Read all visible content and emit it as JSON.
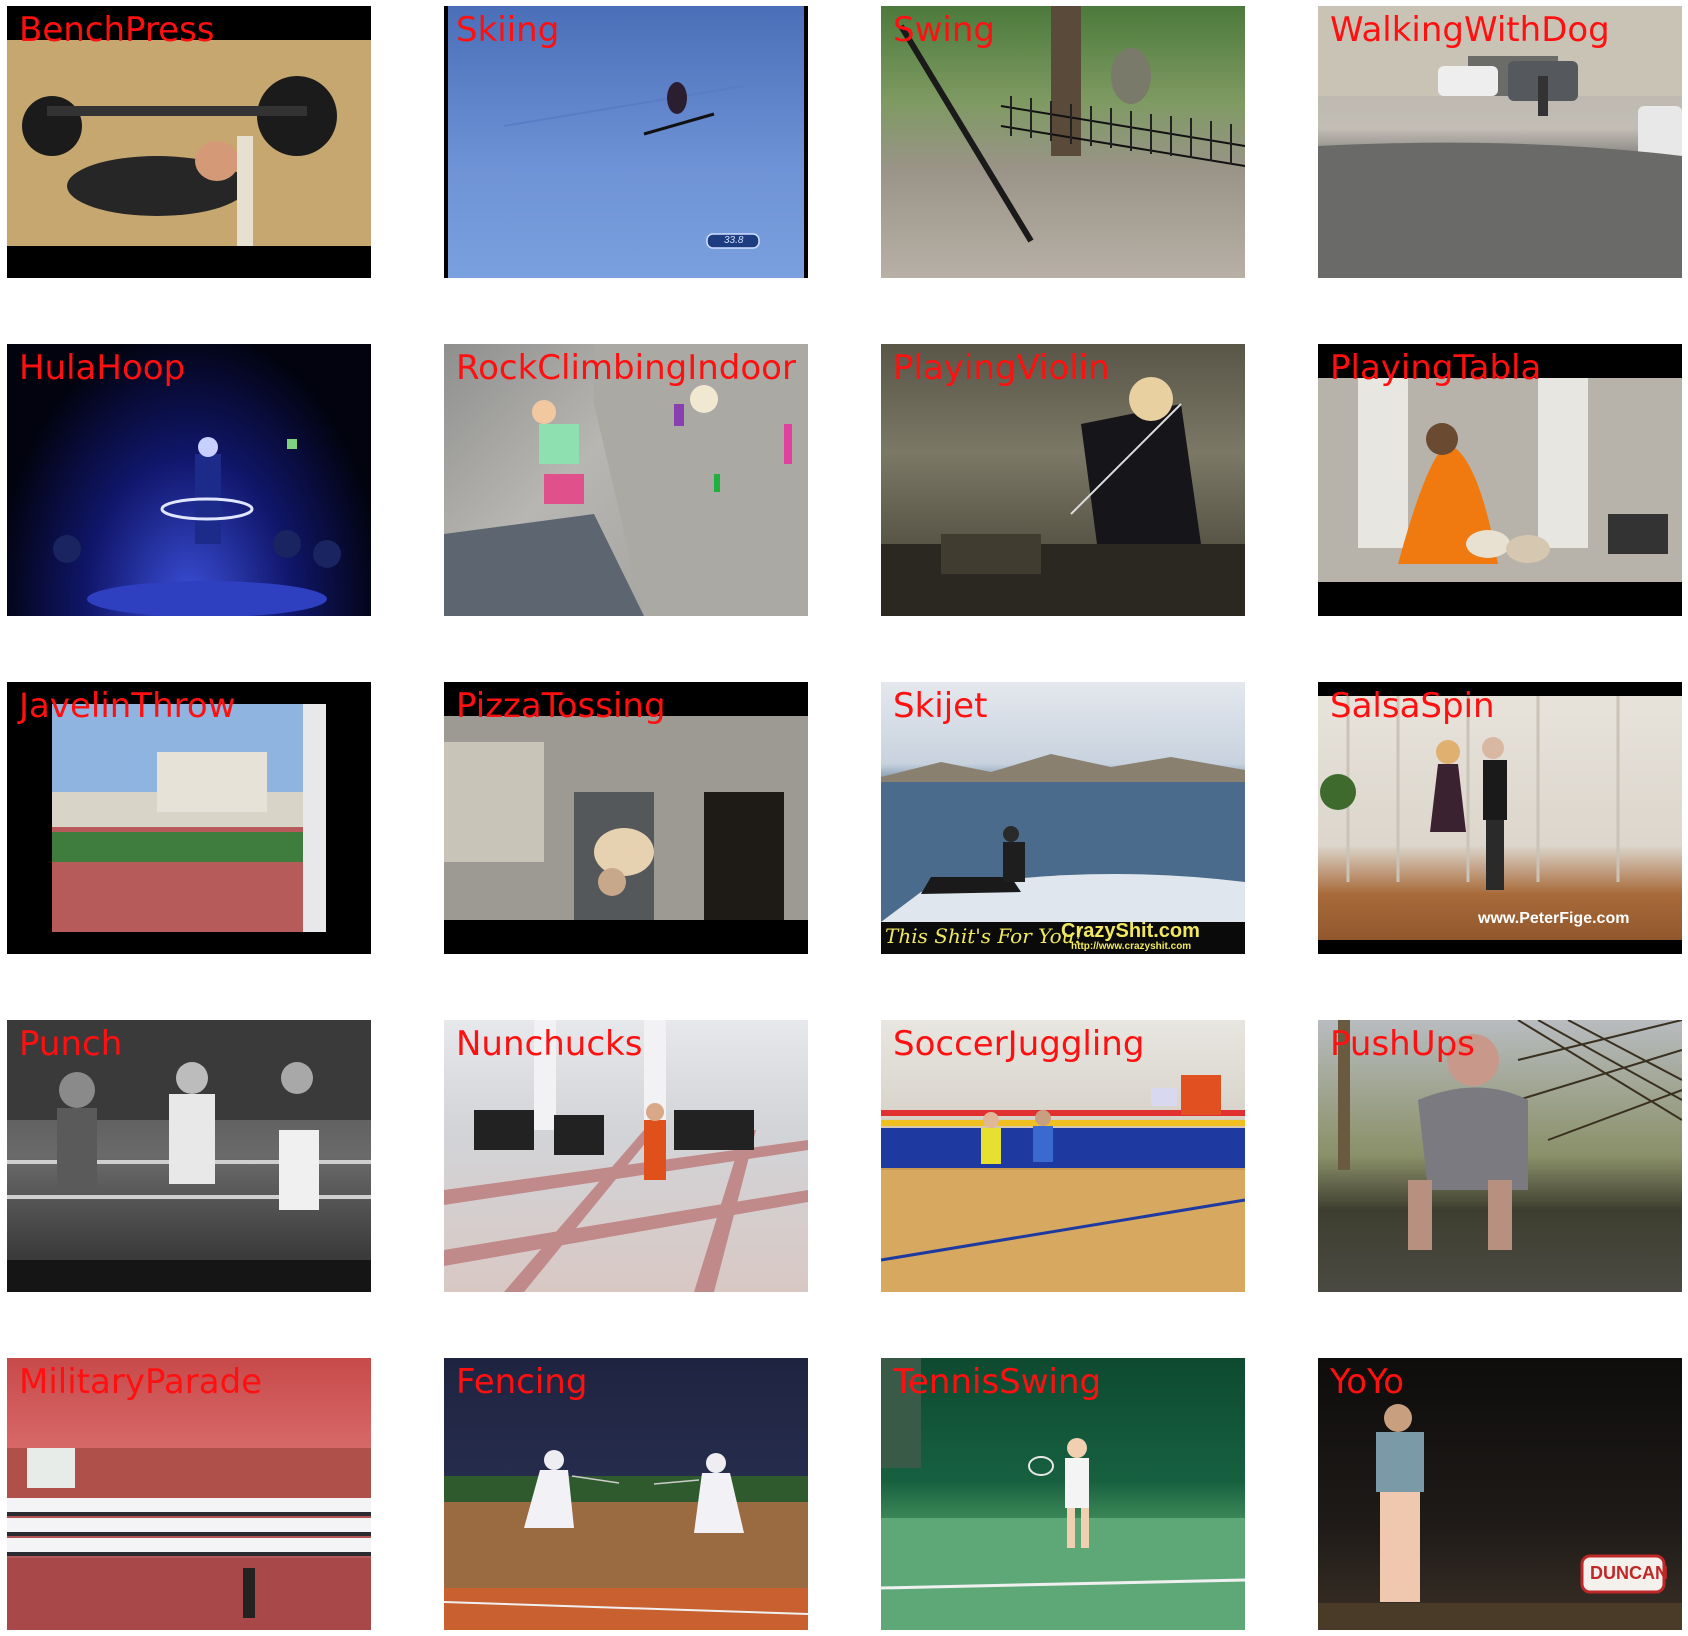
{
  "tiles": [
    {
      "label": "BenchPress"
    },
    {
      "label": "Skiing",
      "overlay": "33.8"
    },
    {
      "label": "Swing"
    },
    {
      "label": "WalkingWithDog"
    },
    {
      "label": "HulaHoop"
    },
    {
      "label": "RockClimbingIndoor"
    },
    {
      "label": "PlayingViolin"
    },
    {
      "label": "PlayingTabla"
    },
    {
      "label": "JavelinThrow"
    },
    {
      "label": "PizzaTossing"
    },
    {
      "label": "Skijet",
      "overlay": "This Shit's For You!",
      "overlay2": "CrazyShit.com",
      "overlay3": "http://www.crazyshit.com"
    },
    {
      "label": "SalsaSpin",
      "overlay": "www.PeterFige.com"
    },
    {
      "label": "Punch"
    },
    {
      "label": "Nunchucks"
    },
    {
      "label": "SoccerJuggling"
    },
    {
      "label": "PushUps"
    },
    {
      "label": "MilitaryParade"
    },
    {
      "label": "Fencing"
    },
    {
      "label": "TennisSwing"
    },
    {
      "label": "YoYo",
      "overlay": "DUNCAN"
    }
  ],
  "colors": {
    "label": "#ff1010",
    "background": "#ffffff"
  }
}
